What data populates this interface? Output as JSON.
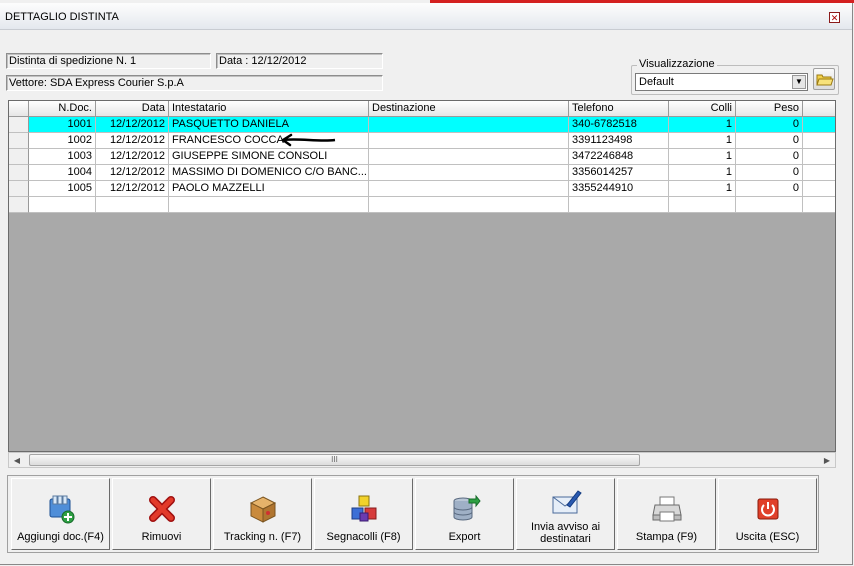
{
  "window": {
    "title": "DETTAGLIO DISTINTA"
  },
  "info": {
    "distinta": "Distinta di spedizione N. 1",
    "data": "Data : 12/12/2012",
    "vettore": "Vettore: SDA Express Courier S.p.A"
  },
  "view": {
    "label": "Visualizzazione",
    "selected": "Default"
  },
  "grid": {
    "columns": [
      "N.Doc.",
      "Data",
      "Intestatario",
      "Destinazione",
      "Telefono",
      "Colli",
      "Peso"
    ],
    "rows": [
      [
        "1001",
        "12/12/2012",
        "PASQUETTO DANIELA",
        "",
        "340-6782518",
        "1",
        "0"
      ],
      [
        "1002",
        "12/12/2012",
        "FRANCESCO COCCA",
        "",
        "3391123498",
        "1",
        "0"
      ],
      [
        "1003",
        "12/12/2012",
        "GIUSEPPE SIMONE CONSOLI",
        "",
        "3472246848",
        "1",
        "0"
      ],
      [
        "1004",
        "12/12/2012",
        "MASSIMO DI DOMENICO C/O BANC...",
        "",
        "3356014257",
        "1",
        "0"
      ],
      [
        "1005",
        "12/12/2012",
        "PAOLO MAZZELLI",
        "",
        "3355244910",
        "1",
        "0"
      ]
    ],
    "selected_row": 0,
    "scroll_thumb_text": "III"
  },
  "toolbar": {
    "buttons": [
      {
        "label": "Aggiungi doc.(F4)",
        "icon": "add-document-icon"
      },
      {
        "label": "Rimuovi",
        "icon": "red-x-icon"
      },
      {
        "label": "Tracking n. (F7)",
        "icon": "package-box-icon"
      },
      {
        "label": "Segnacolli (F8)",
        "icon": "colored-cubes-icon"
      },
      {
        "label": "Export",
        "icon": "database-export-icon"
      },
      {
        "label": "Invia avviso ai destinatari",
        "icon": "envelope-pen-icon"
      },
      {
        "label": "Stampa (F9)",
        "icon": "printer-icon"
      },
      {
        "label": "Uscita (ESC)",
        "icon": "power-exit-icon"
      }
    ]
  },
  "colors": {
    "selected_row": "#00ffff",
    "grid_background": "#a9a9a9",
    "window": "#f0f0f0"
  }
}
